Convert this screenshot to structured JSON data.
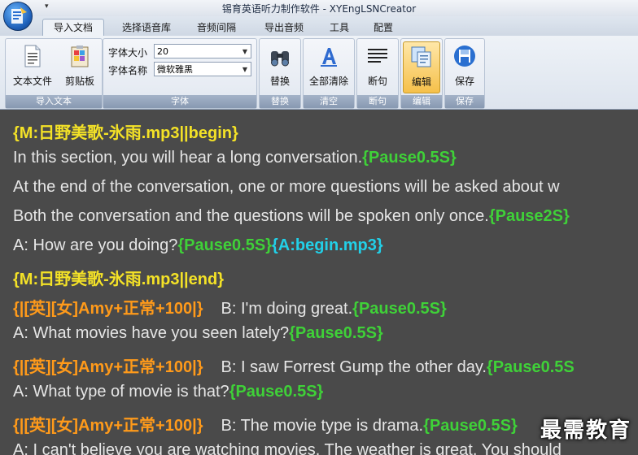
{
  "window": {
    "title": "锡育英语听力制作软件 - XYEngLSNCreator",
    "qat_glyph": "▾"
  },
  "tabs": [
    "导入文档",
    "选择语音库",
    "音频间隔",
    "导出音频",
    "工具",
    "配置"
  ],
  "ribbon": {
    "import_group": {
      "label": "导入文本",
      "text_file": "文本文件",
      "clipboard": "剪贴板"
    },
    "font_group": {
      "label": "字体",
      "size_label": "字体大小",
      "size_value": "20",
      "name_label": "字体名称",
      "name_value": "微软雅黑"
    },
    "replace_group": {
      "label": "替换",
      "button": "替换"
    },
    "clear_group": {
      "label": "清空",
      "button": "全部清除"
    },
    "break_group": {
      "label": "断句",
      "button": "断句"
    },
    "edit_group": {
      "label": "编辑",
      "button": "编辑"
    },
    "save_group": {
      "label": "保存",
      "button": "保存"
    }
  },
  "editor": {
    "l1": "{M:日野美歌-氷雨.mp3||begin}",
    "l2_text": "In this section, you will hear a long conversation.",
    "l2_tag": "{Pause0.5S}",
    "l3_text": "At the end of the conversation, one or more questions will be asked about w",
    "l4_text": "Both the conversation and the questions will be spoken only once.",
    "l4_tag": "{Pause2S}",
    "l5_text": "A: How are you doing?",
    "l5_tag": "{Pause0.5S}",
    "l5_tag2": "{A:begin.mp3}",
    "l6": "{M:日野美歌-氷雨.mp3||end}",
    "l7_voice": "{|[英][女]Amy+正常+100|}",
    "l7_text": "B: I'm doing great.",
    "l7_tag": "{Pause0.5S}",
    "l8_text": "A: What movies have you seen lately?",
    "l8_tag": "{Pause0.5S}",
    "l9_voice": "{|[英][女]Amy+正常+100|}",
    "l9_text": "B: I saw Forrest Gump the other day.",
    "l9_tag": "{Pause0.5S",
    "l10_text": "A: What type of movie is that?",
    "l10_tag": "{Pause0.5S}",
    "l11_voice": "{|[英][女]Amy+正常+100|}",
    "l11_text": "B: The movie type is drama.",
    "l11_tag": "{Pause0.5S}",
    "l12_text": "A: I can't believe you are watching movies. The weather is great. You should"
  },
  "watermark": "最需教育"
}
